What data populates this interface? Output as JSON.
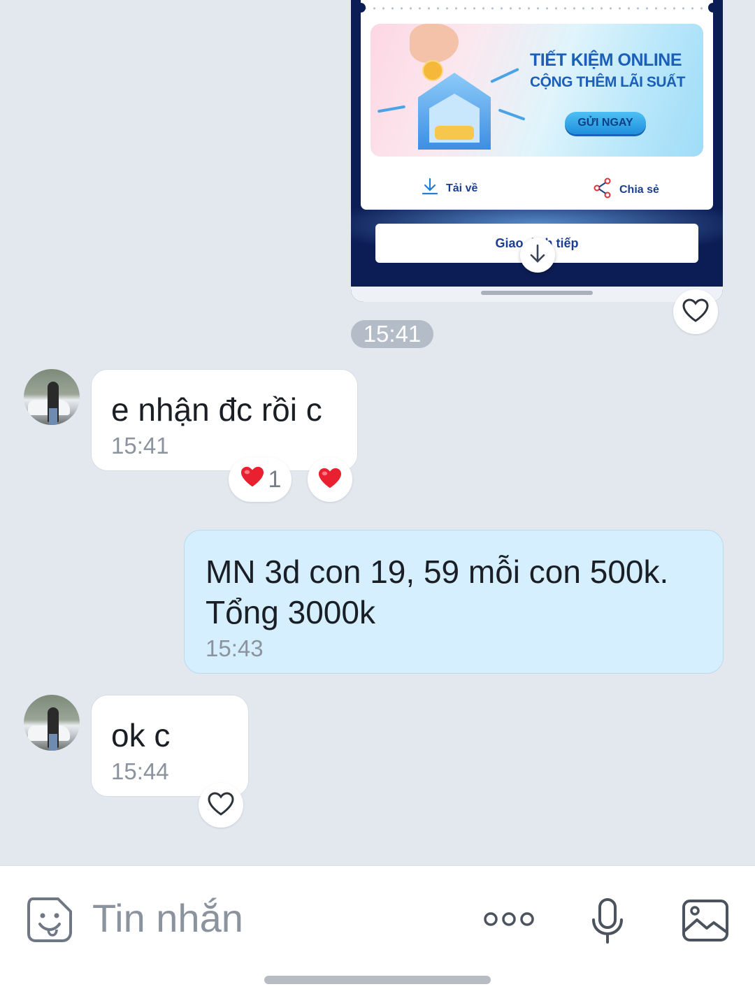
{
  "image_message": {
    "banner_title": "TIẾT KIỆM ONLINE",
    "banner_subtitle": "CỘNG THÊM LÃI SUẤT",
    "banner_button": "GỬI NGAY",
    "download_label": "Tải về",
    "share_label": "Chia sẻ",
    "continue_label": "Giao dịch tiếp"
  },
  "time_separator": "15:41",
  "messages": [
    {
      "from": "contact",
      "text": "e nhận đc rồi c",
      "time": "15:41",
      "reaction_count": "1"
    },
    {
      "from": "me",
      "text": "MN 3d con 19, 59 mỗi con 500k. Tổng 3000k",
      "time": "15:43"
    },
    {
      "from": "contact",
      "text": "ok c",
      "time": "15:44"
    }
  ],
  "input": {
    "placeholder": "Tin nhắn"
  },
  "icons": {
    "emoji": "sticker-smile-icon",
    "more": "more-dots-icon",
    "mic": "microphone-icon",
    "gallery": "image-gallery-icon",
    "heart_outline": "heart-outline-icon",
    "heart_filled": "heart-filled-icon"
  },
  "colors": {
    "heart": "#e8202f",
    "sent_bubble": "#d6efff",
    "background": "#e3e8ef"
  }
}
